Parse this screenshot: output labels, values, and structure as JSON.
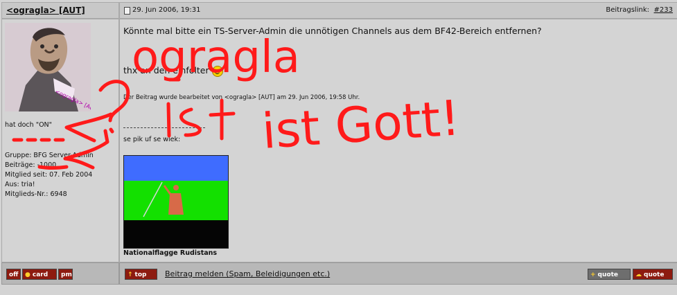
{
  "post": {
    "author_link": "<ogragla> [AUT]",
    "date": "29. Jun 2006, 19:31",
    "link_label": "Beitragslink:",
    "link_value": "#233",
    "body_line1": "Könnte mal bitte ein TS-Server-Admin die unnötigen Channels aus dem BF42-Bereich entfernen?",
    "body_line2": "thx an den einfolter",
    "edited_note": "Der Beitrag wurde bearbeitet von <ogragla> [AUT] am 29. Jun 2006, 19:58 Uhr.",
    "signature_text": "se pik uf se wiek:",
    "flag_caption": "Nationalflagge Rudistans"
  },
  "user": {
    "status_line": "hat doch \"ON\"",
    "group": "Gruppe: BFG Server-Admin",
    "posts": "Beiträge: -1000",
    "member_since": "Mitglied seit: 07. Feb 2004",
    "location": "Aus: tria!",
    "member_no": "Mitglieds-Nr.: 6948",
    "avatar_caption": "<ogragla> [AUT]"
  },
  "actions": {
    "off": "off",
    "card": "card",
    "pm": "pm",
    "top": "top",
    "report": "Beitrag melden (Spam, Beleidigungen etc.)",
    "multiquote": "quote",
    "quote": "quote"
  },
  "overlay": {
    "color": "#ff1a1a",
    "line1": "ogragla",
    "line2": "ist Gott!"
  },
  "colors": {
    "panel": "#d4d4d4",
    "header": "#c8c8c8",
    "button_dark": "#8d1b10",
    "flag_top": "#3f6cff",
    "flag_middle": "#13e000",
    "flag_bottom": "#050505"
  }
}
